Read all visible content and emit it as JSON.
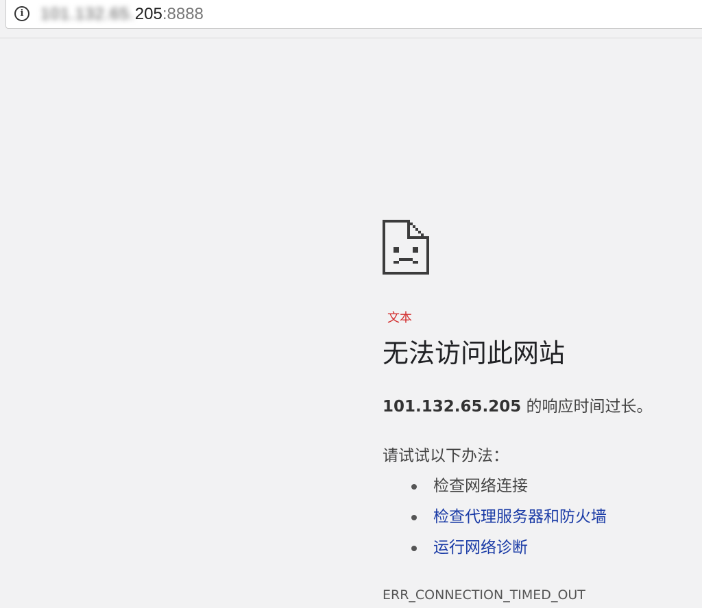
{
  "address_bar": {
    "info_icon": "info-icon",
    "host_blurred": "101.132.65.",
    "host_tail": "205",
    "port": ":8888"
  },
  "error_page": {
    "icon": "sad-document-icon",
    "label": "文本",
    "label_color": "#d32f2f",
    "title": "无法访问此网站",
    "summary_host": "101.132.65.205",
    "summary_text": " 的响应时间过长。",
    "suggestions_title": "请试试以下办法：",
    "suggestions": [
      {
        "label": "检查网络连接",
        "is_link": false
      },
      {
        "label": "检查代理服务器和防火墙",
        "is_link": true
      },
      {
        "label": "运行网络诊断",
        "is_link": true
      }
    ],
    "error_code": "ERR_CONNECTION_TIMED_OUT",
    "link_color": "#1a3ba6"
  }
}
